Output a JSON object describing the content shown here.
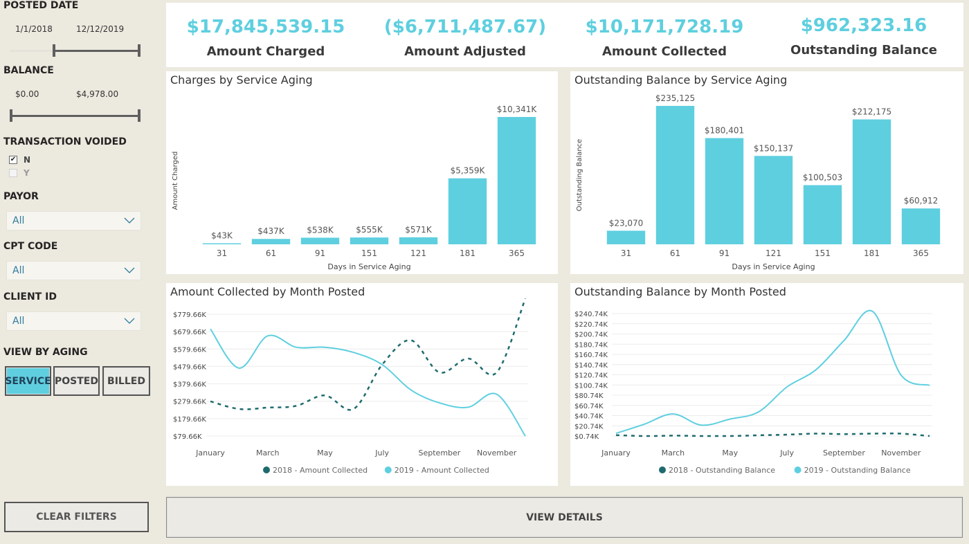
{
  "filters": {
    "posted_date": {
      "heading": "POSTED DATE",
      "start": "1/1/2018",
      "end": "12/12/2019"
    },
    "balance": {
      "heading": "BALANCE",
      "min": "$0.00",
      "max": "$4,978.00"
    },
    "transaction_voided": {
      "heading": "TRANSACTION VOIDED",
      "options": [
        {
          "label": "N",
          "checked": true
        },
        {
          "label": "Y",
          "checked": false
        }
      ]
    },
    "payor": {
      "heading": "PAYOR",
      "value": "All"
    },
    "cpt_code": {
      "heading": "CPT CODE",
      "value": "All"
    },
    "client_id": {
      "heading": "CLIENT ID",
      "value": "All"
    },
    "view_by_aging": {
      "heading": "VIEW BY AGING",
      "options": [
        "SERVICE",
        "POSTED",
        "BILLED"
      ],
      "selected": "SERVICE"
    },
    "clear_label": "CLEAR FILTERS"
  },
  "kpis": [
    {
      "value": "$17,845,539.15",
      "label": "Amount Charged"
    },
    {
      "value": "($6,711,487.67)",
      "label": "Amount Adjusted"
    },
    {
      "value": "$10,171,728.19",
      "label": "Amount Collected"
    },
    {
      "value": "$962,323.16",
      "label": "Outstanding Balance"
    }
  ],
  "colors": {
    "accent": "#5ecfdf",
    "dark_series": "#1e6b6e",
    "background": "#ece9df"
  },
  "view_details_label": "VIEW DETAILS",
  "chart_data": [
    {
      "type": "bar",
      "title": "Charges by Service Aging",
      "xlabel": "Days in Service Aging",
      "ylabel": "Amount Charged",
      "categories": [
        "31",
        "61",
        "91",
        "151",
        "121",
        "181",
        "365"
      ],
      "values": [
        43,
        437,
        538,
        555,
        571,
        5359,
        10341
      ],
      "data_labels": [
        "$43K",
        "$437K",
        "$538K",
        "$555K",
        "$571K",
        "$5,359K",
        "$10,341K"
      ],
      "ylim": [
        0,
        10341
      ]
    },
    {
      "type": "bar",
      "title": "Outstanding Balance by Service Aging",
      "xlabel": "Days in Service Aging",
      "ylabel": "Outstanding Balance",
      "categories": [
        "31",
        "61",
        "91",
        "121",
        "151",
        "181",
        "365"
      ],
      "values": [
        23070,
        235125,
        180401,
        150137,
        100503,
        212175,
        60912
      ],
      "data_labels": [
        "$23,070",
        "$235,125",
        "$180,401",
        "$150,137",
        "$100,503",
        "$212,175",
        "$60,912"
      ],
      "ylim": [
        0,
        235125
      ]
    },
    {
      "type": "line",
      "title": "Amount Collected by Month Posted",
      "x_tick_labels": [
        "January",
        "March",
        "May",
        "July",
        "September",
        "November"
      ],
      "y_tick_labels": [
        "$79.66K",
        "$179.66K",
        "$279.66K",
        "$379.66K",
        "$479.66K",
        "$579.66K",
        "$679.66K",
        "$779.66K"
      ],
      "y_ticks": [
        79.66,
        179.66,
        279.66,
        379.66,
        479.66,
        579.66,
        679.66,
        779.66
      ],
      "ylim": [
        79.66,
        779.66
      ],
      "grid": true,
      "legend_position": "bottom",
      "x": [
        "January",
        "February",
        "March",
        "April",
        "May",
        "June",
        "July",
        "August",
        "September",
        "October",
        "November",
        "December"
      ],
      "series": [
        {
          "name": "2018 - Amount Collected",
          "style": "dashed",
          "color": "#1e6b6e",
          "values": [
            279,
            235,
            243,
            253,
            313,
            235,
            490,
            630,
            445,
            525,
            445,
            870
          ]
        },
        {
          "name": "2019 - Amount Collected",
          "style": "solid",
          "color": "#5ecfdf",
          "values": [
            695,
            470,
            655,
            590,
            590,
            560,
            490,
            345,
            270,
            245,
            320,
            79.66
          ]
        }
      ]
    },
    {
      "type": "line",
      "title": "Outstanding Balance by Month Posted",
      "x_tick_labels": [
        "January",
        "March",
        "May",
        "July",
        "September",
        "November"
      ],
      "y_tick_labels": [
        "$0.74K",
        "$20.74K",
        "$40.74K",
        "$60.74K",
        "$80.74K",
        "$100.74K",
        "$120.74K",
        "$140.74K",
        "$160.74K",
        "$180.74K",
        "$200.74K",
        "$220.74K",
        "$240.74K"
      ],
      "y_ticks": [
        0.74,
        20.74,
        40.74,
        60.74,
        80.74,
        100.74,
        120.74,
        140.74,
        160.74,
        180.74,
        200.74,
        220.74,
        240.74
      ],
      "ylim": [
        0.74,
        240.74
      ],
      "grid": true,
      "legend_position": "bottom",
      "x": [
        "January",
        "February",
        "March",
        "April",
        "May",
        "June",
        "July",
        "August",
        "September",
        "October",
        "November",
        "December"
      ],
      "series": [
        {
          "name": "2018 - Outstanding Balance",
          "style": "dashed",
          "color": "#1e6b6e",
          "values": [
            2.5,
            0.7,
            1.5,
            0.8,
            0.8,
            2.2,
            3.5,
            5.5,
            4.5,
            5.5,
            5.5,
            0.7
          ]
        },
        {
          "name": "2019 - Outstanding Balance",
          "style": "solid",
          "color": "#5ecfdf",
          "values": [
            6,
            24,
            44,
            22,
            34,
            48,
            97,
            130,
            188,
            245,
            120,
            100
          ]
        }
      ]
    }
  ]
}
